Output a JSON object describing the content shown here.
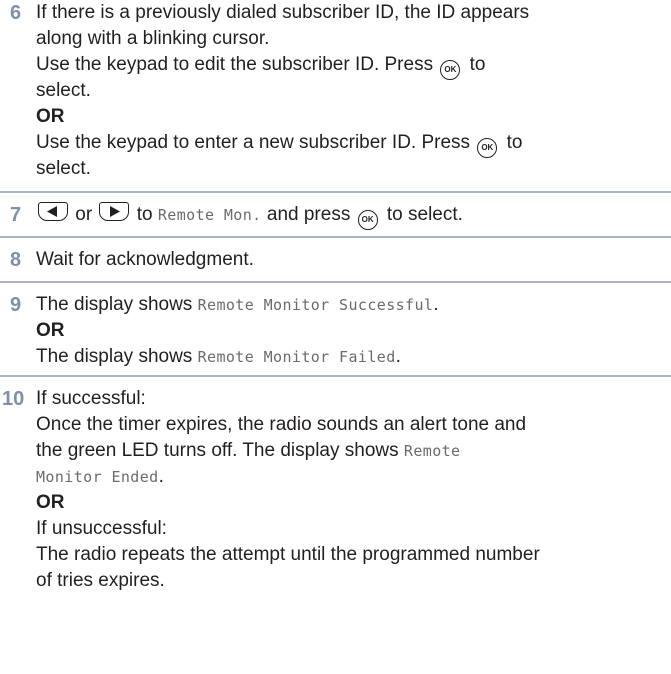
{
  "steps": [
    {
      "number": "6",
      "lines": [
        {
          "text": "If there is a previously dialed subscriber ID, the ID appears"
        },
        {
          "text": "along with a blinking cursor."
        },
        {
          "pre": "Use the keypad to edit the subscriber ID. Press ",
          "post": " to"
        },
        {
          "text": "select."
        },
        {
          "text": "OR"
        },
        {
          "pre": "Use the keypad to enter a new subscriber ID. Press ",
          "post": " to"
        },
        {
          "text": "select."
        }
      ]
    },
    {
      "number": "7",
      "or_word": " or ",
      "to_word": " to ",
      "menu_item": "Remote Mon.",
      "post": " and press ",
      "tail": " to select."
    },
    {
      "number": "8",
      "text": "Wait for acknowledgment."
    },
    {
      "number": "9",
      "line1_pre": "The display shows ",
      "line1_mono": "Remote Monitor Successful",
      "line1_post": ".",
      "or": "OR",
      "line2_pre": "The display shows ",
      "line2_mono": "Remote Monitor Failed",
      "line2_post": "."
    },
    {
      "number": "10",
      "line1": "If successful:",
      "line2": "Once the timer expires, the radio sounds an alert tone and",
      "line3_pre": "the green LED turns off. The display shows ",
      "line3_mono": "Remote",
      "line4_mono": "Monitor Ended",
      "line4_post": ".",
      "or": "OR",
      "line5": "If unsuccessful:",
      "line6": "The radio repeats the attempt until the programmed number",
      "line7": "of tries expires."
    }
  ],
  "icons": {
    "ok_button_label": "OK",
    "left_nav": "left-navigation-button-icon",
    "right_nav": "right-navigation-button-icon",
    "ok": "ok-button-icon"
  },
  "colors": {
    "step_number": "#7f90ab",
    "rule": "#a9b5c6",
    "mono_text": "#6b6b6b"
  }
}
